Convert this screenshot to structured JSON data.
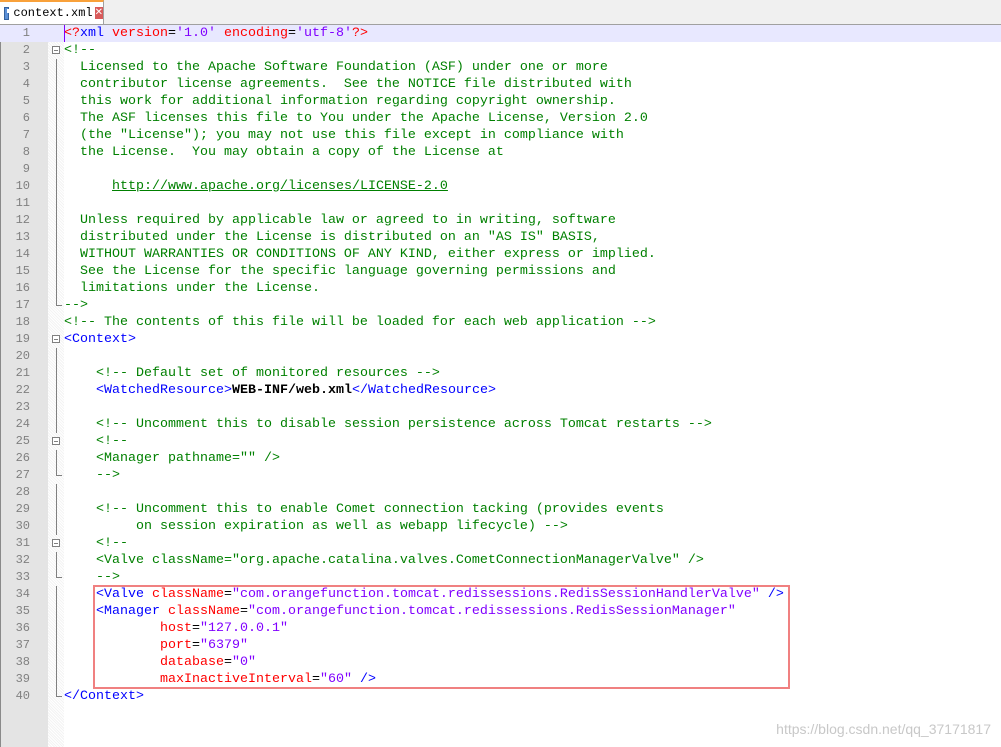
{
  "tab": {
    "title": "context.xml",
    "save_icon": "floppy-disk-icon",
    "close_icon": "close-icon"
  },
  "lines": [
    [
      [
        "pi",
        "<?"
      ],
      [
        "tag",
        "xml"
      ],
      [
        "txt",
        " "
      ],
      [
        "attr",
        "version"
      ],
      [
        "eq",
        "="
      ],
      [
        "val",
        "'1.0'"
      ],
      [
        "txt",
        " "
      ],
      [
        "attr",
        "encoding"
      ],
      [
        "eq",
        "="
      ],
      [
        "val",
        "'utf-8'"
      ],
      [
        "pi",
        "?>"
      ]
    ],
    [
      [
        "com",
        "<!--"
      ]
    ],
    [
      [
        "com",
        "  Licensed to the Apache Software Foundation (ASF) under one or more"
      ]
    ],
    [
      [
        "com",
        "  contributor license agreements.  See the NOTICE file distributed with"
      ]
    ],
    [
      [
        "com",
        "  this work for additional information regarding copyright ownership."
      ]
    ],
    [
      [
        "com",
        "  The ASF licenses this file to You under the Apache License, Version 2.0"
      ]
    ],
    [
      [
        "com",
        "  (the \"License\"); you may not use this file except in compliance with"
      ]
    ],
    [
      [
        "com",
        "  the License.  You may obtain a copy of the License at"
      ]
    ],
    [
      [
        "com",
        ""
      ]
    ],
    [
      [
        "com",
        "      "
      ],
      [
        "link",
        "http://www.apache.org/licenses/LICENSE-2.0"
      ]
    ],
    [
      [
        "com",
        ""
      ]
    ],
    [
      [
        "com",
        "  Unless required by applicable law or agreed to in writing, software"
      ]
    ],
    [
      [
        "com",
        "  distributed under the License is distributed on an \"AS IS\" BASIS,"
      ]
    ],
    [
      [
        "com",
        "  WITHOUT WARRANTIES OR CONDITIONS OF ANY KIND, either express or implied."
      ]
    ],
    [
      [
        "com",
        "  See the License for the specific language governing permissions and"
      ]
    ],
    [
      [
        "com",
        "  limitations under the License."
      ]
    ],
    [
      [
        "com",
        "-->"
      ]
    ],
    [
      [
        "com",
        "<!-- The contents of this file will be loaded for each web application -->"
      ]
    ],
    [
      [
        "tag",
        "<Context>"
      ]
    ],
    [
      [
        "txt",
        ""
      ]
    ],
    [
      [
        "txt",
        "    "
      ],
      [
        "com",
        "<!-- Default set of monitored resources -->"
      ]
    ],
    [
      [
        "txt",
        "    "
      ],
      [
        "tag",
        "<WatchedResource>"
      ],
      [
        "txtc",
        "WEB-INF/web.xml"
      ],
      [
        "tag",
        "</WatchedResource>"
      ]
    ],
    [
      [
        "txt",
        ""
      ]
    ],
    [
      [
        "txt",
        "    "
      ],
      [
        "com",
        "<!-- Uncomment this to disable session persistence across Tomcat restarts -->"
      ]
    ],
    [
      [
        "txt",
        "    "
      ],
      [
        "com",
        "<!--"
      ]
    ],
    [
      [
        "com",
        "    <Manager pathname=\"\" />"
      ]
    ],
    [
      [
        "com",
        "    -->"
      ]
    ],
    [
      [
        "txt",
        ""
      ]
    ],
    [
      [
        "txt",
        "    "
      ],
      [
        "com",
        "<!-- Uncomment this to enable Comet connection tacking (provides events"
      ]
    ],
    [
      [
        "com",
        "         on session expiration as well as webapp lifecycle) -->"
      ]
    ],
    [
      [
        "txt",
        "    "
      ],
      [
        "com",
        "<!--"
      ]
    ],
    [
      [
        "com",
        "    <Valve className=\"org.apache.catalina.valves.CometConnectionManagerValve\" />"
      ]
    ],
    [
      [
        "com",
        "    -->"
      ]
    ],
    [
      [
        "txt",
        "    "
      ],
      [
        "tag",
        "<Valve"
      ],
      [
        "txt",
        " "
      ],
      [
        "attr",
        "className"
      ],
      [
        "eq",
        "="
      ],
      [
        "val",
        "\"com.orangefunction.tomcat.redissessions.RedisSessionHandlerValve\""
      ],
      [
        "txt",
        " "
      ],
      [
        "tag",
        "/>"
      ]
    ],
    [
      [
        "txt",
        "    "
      ],
      [
        "tag",
        "<Manager"
      ],
      [
        "txt",
        " "
      ],
      [
        "attr",
        "className"
      ],
      [
        "eq",
        "="
      ],
      [
        "val",
        "\"com.orangefunction.tomcat.redissessions.RedisSessionManager\""
      ]
    ],
    [
      [
        "txt",
        "            "
      ],
      [
        "attr",
        "host"
      ],
      [
        "eq",
        "="
      ],
      [
        "val",
        "\"127.0.0.1\""
      ]
    ],
    [
      [
        "txt",
        "            "
      ],
      [
        "attr",
        "port"
      ],
      [
        "eq",
        "="
      ],
      [
        "val",
        "\"6379\""
      ]
    ],
    [
      [
        "txt",
        "            "
      ],
      [
        "attr",
        "database"
      ],
      [
        "eq",
        "="
      ],
      [
        "val",
        "\"0\""
      ]
    ],
    [
      [
        "txt",
        "            "
      ],
      [
        "attr",
        "maxInactiveInterval"
      ],
      [
        "eq",
        "="
      ],
      [
        "val",
        "\"60\""
      ],
      [
        "txt",
        " "
      ],
      [
        "tag",
        "/>"
      ]
    ],
    [
      [
        "tag",
        "</Context>"
      ]
    ]
  ],
  "watermark": "https://blog.csdn.net/qq_37171817"
}
